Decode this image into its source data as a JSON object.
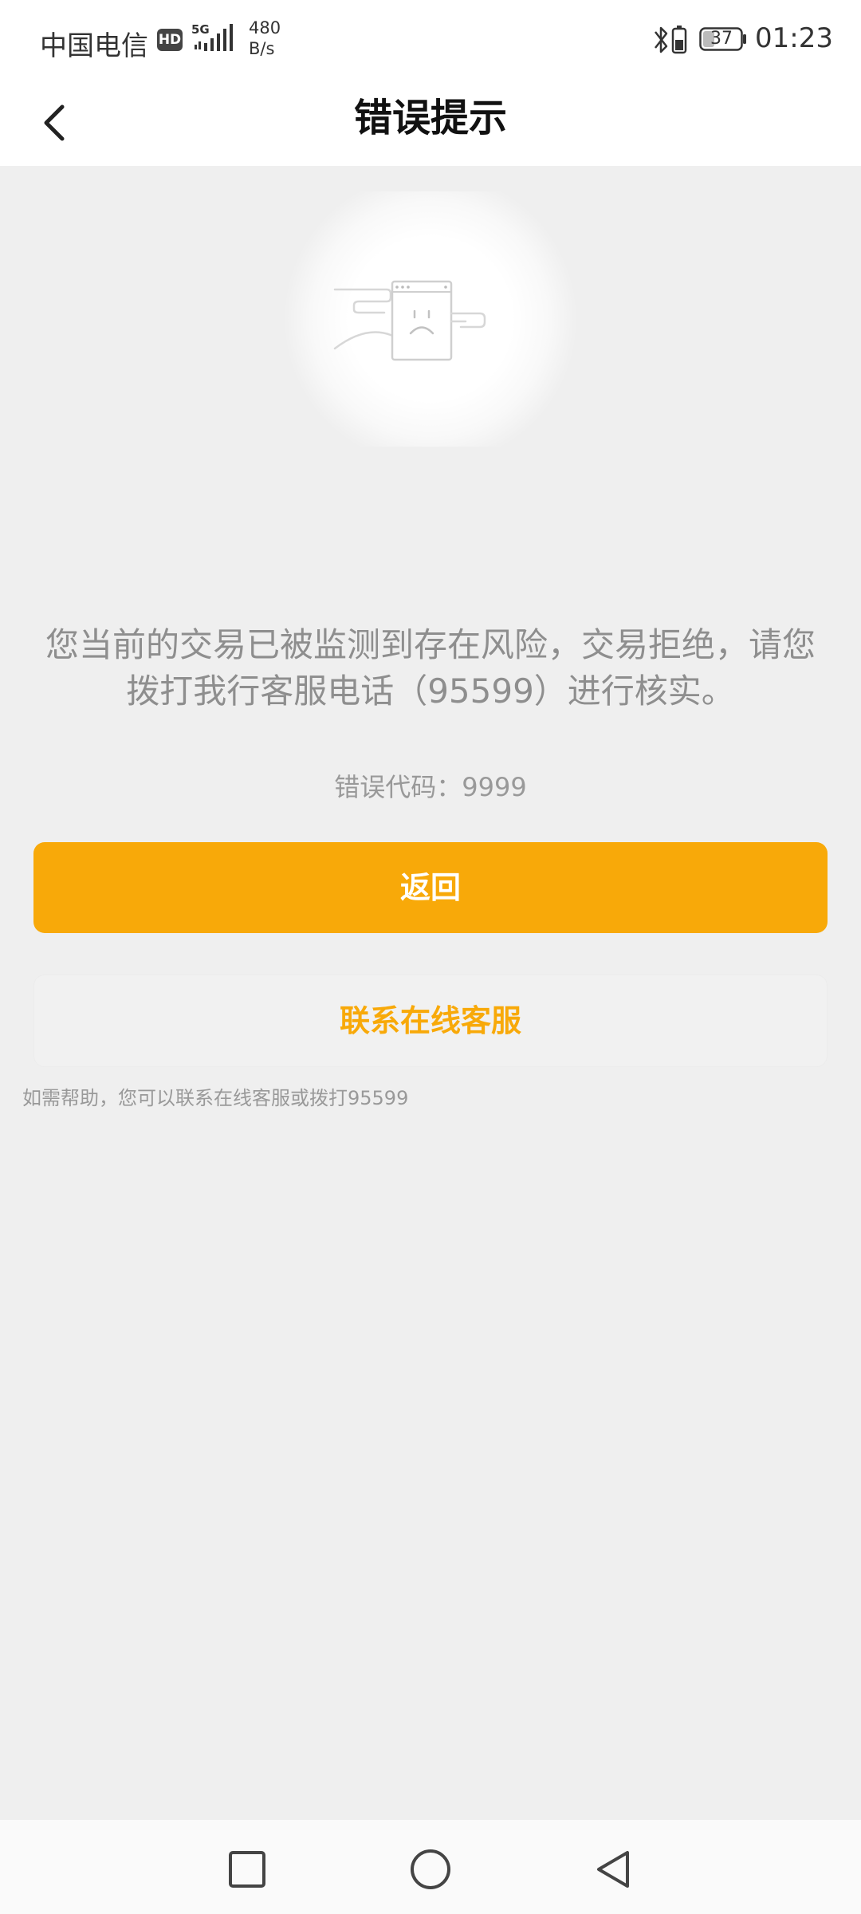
{
  "status_bar": {
    "carrier": "中国电信",
    "hd_badge": "HD",
    "network_type": "5G",
    "net_speed_value": "480",
    "net_speed_unit": "B/s",
    "battery_level": "37",
    "time": "01:23"
  },
  "nav": {
    "title": "错误提示"
  },
  "content": {
    "message": "您当前的交易已被监测到存在风险，交易拒绝，请您拨打我行客服电话（95599）进行核实。",
    "error_code": "错误代码：9999",
    "primary_button_label": "返回",
    "secondary_button_label": "联系在线客服",
    "help_text": "如需帮助，您可以联系在线客服或拨打95599"
  },
  "colors": {
    "accent": "#f8a909",
    "background": "#efefef",
    "message_text": "#8e8e8e"
  },
  "icons": {
    "back": "chevron-left-icon",
    "illustration": "sad-browser-window-illustration",
    "recents": "square-icon",
    "home": "circle-icon",
    "system_back": "triangle-left-icon"
  }
}
